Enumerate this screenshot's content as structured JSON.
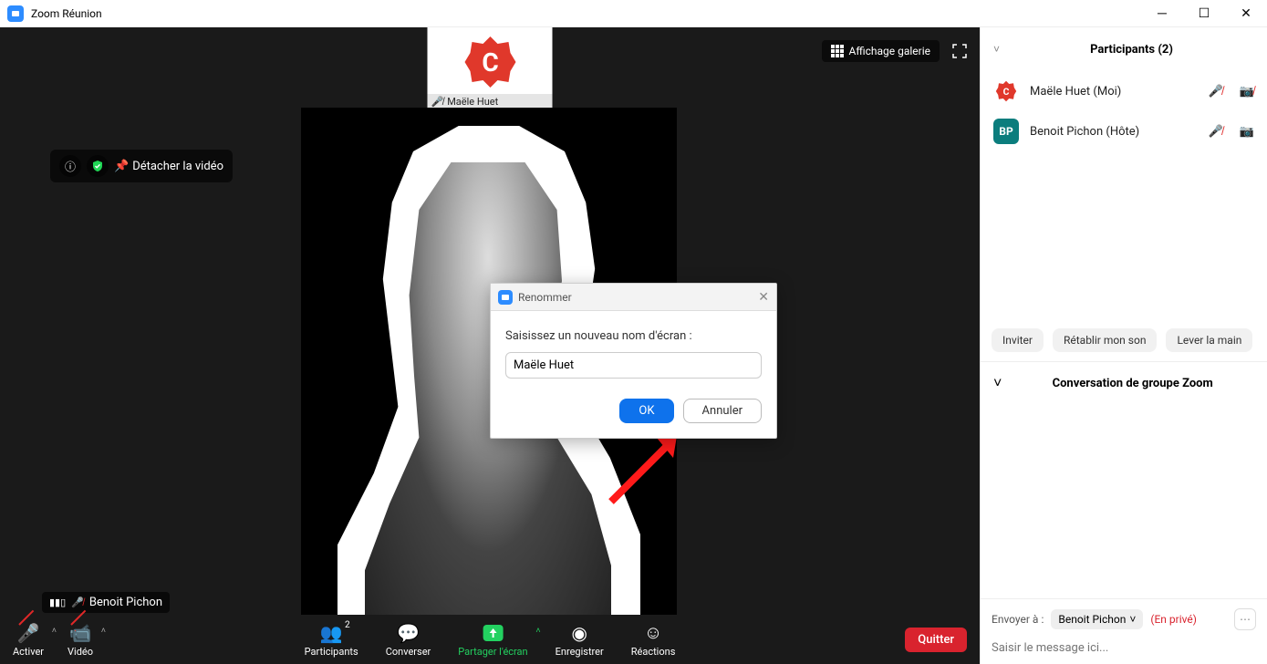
{
  "window": {
    "title": "Zoom Réunion"
  },
  "gallery_label": "Affichage galerie",
  "pin_label": "Détacher la vidéo",
  "pinned_thumb_name": "Maële Huet",
  "main_speaker_name": "Benoit Pichon",
  "dialog": {
    "title": "Renommer",
    "prompt": "Saisissez un nouveau nom d'écran :",
    "value": "Maële Huet",
    "ok": "OK",
    "cancel": "Annuler"
  },
  "toolbar": {
    "activate": "Activer",
    "video": "Vidéo",
    "participants": "Participants",
    "participants_count": "2",
    "chat": "Converser",
    "share": "Partager l'écran",
    "record": "Enregistrer",
    "reactions": "Réactions",
    "leave": "Quitter"
  },
  "sidepanel": {
    "participants_title": "Participants (2)",
    "participants": [
      {
        "name": "Maële Huet (Moi)",
        "avatar": "C",
        "avatar_type": "c"
      },
      {
        "name": "Benoit Pichon (Hôte)",
        "avatar": "BP",
        "avatar_type": "bp"
      }
    ],
    "invite": "Inviter",
    "restore_sound": "Rétablir mon son",
    "raise_hand": "Lever la main",
    "chat_title": "Conversation de groupe Zoom",
    "chat_to_label": "Envoyer à :",
    "chat_to_target": "Benoit Pichon",
    "chat_private": "(En privé)",
    "chat_placeholder": "Saisir le message ici..."
  }
}
